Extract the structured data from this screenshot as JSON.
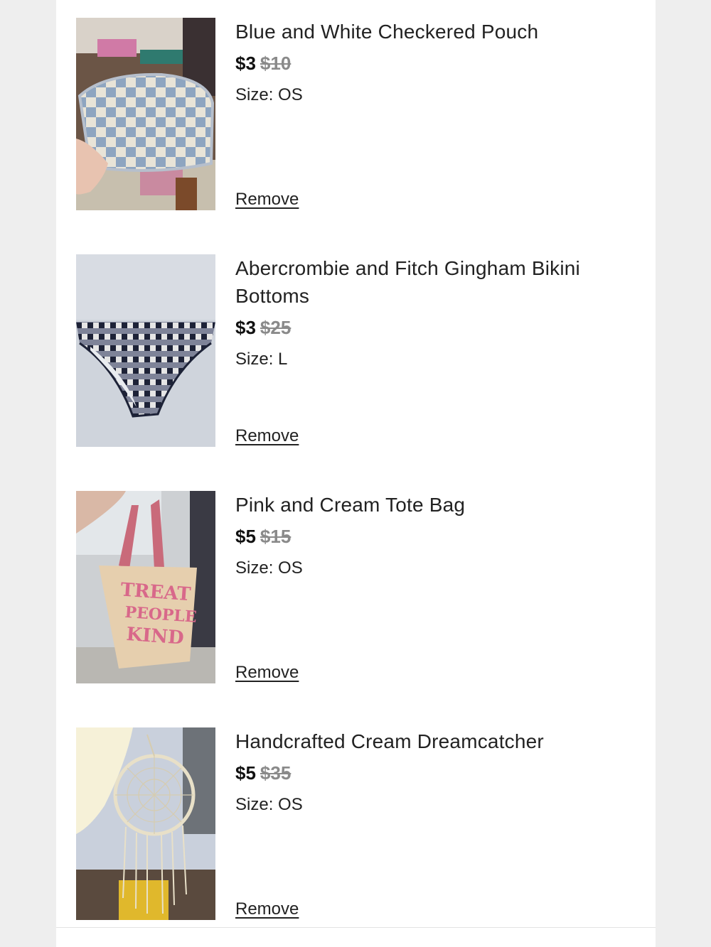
{
  "cart": {
    "items": [
      {
        "title": "Blue and White Checkered Pouch",
        "price": "$3",
        "original_price": "$10",
        "size_label": "Size: OS",
        "remove_label": "Remove"
      },
      {
        "title": "Abercrombie and Fitch Gingham Bikini Bottoms",
        "price": "$3",
        "original_price": "$25",
        "size_label": "Size: L",
        "remove_label": "Remove"
      },
      {
        "title": "Pink and Cream Tote Bag",
        "price": "$5",
        "original_price": "$15",
        "size_label": "Size: OS",
        "remove_label": "Remove"
      },
      {
        "title": "Handcrafted Cream Dreamcatcher",
        "price": "$5",
        "original_price": "$35",
        "size_label": "Size: OS",
        "remove_label": "Remove"
      }
    ]
  }
}
